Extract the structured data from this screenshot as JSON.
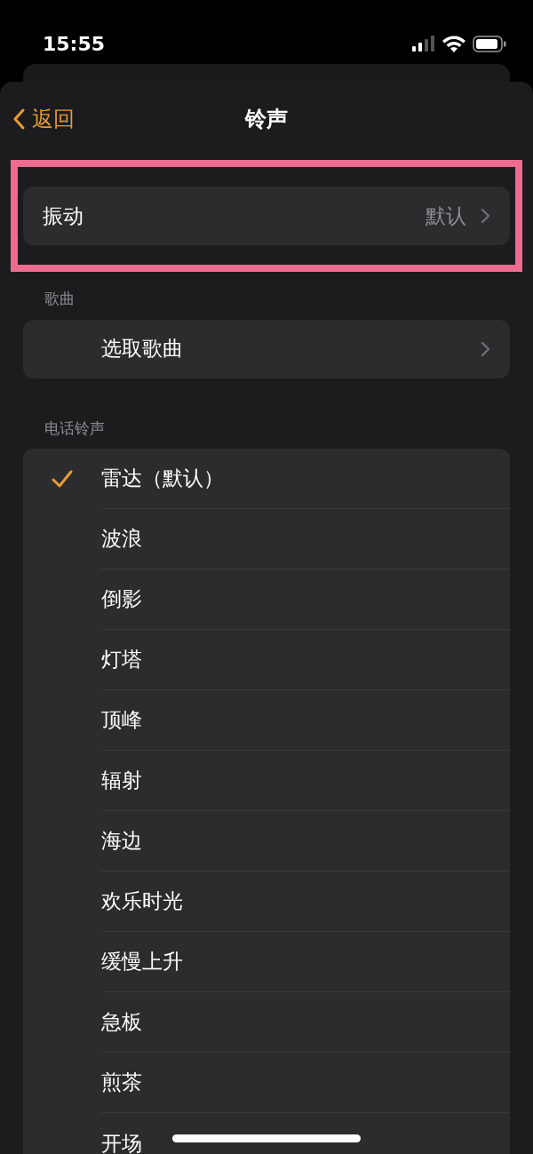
{
  "status_bar": {
    "time": "15:55"
  },
  "nav": {
    "back": "返回",
    "title": "铃声"
  },
  "vibration": {
    "label": "振动",
    "value": "默认",
    "highlighted": true
  },
  "sections": [
    {
      "header": "歌曲",
      "rows": [
        {
          "label": "选取歌曲",
          "kind": "link"
        }
      ]
    },
    {
      "header": "电话铃声",
      "rows": [
        {
          "label": "雷达（默认）",
          "kind": "option",
          "selected": true
        },
        {
          "label": "波浪",
          "kind": "option",
          "selected": false
        },
        {
          "label": "倒影",
          "kind": "option",
          "selected": false
        },
        {
          "label": "灯塔",
          "kind": "option",
          "selected": false
        },
        {
          "label": "顶峰",
          "kind": "option",
          "selected": false
        },
        {
          "label": "辐射",
          "kind": "option",
          "selected": false
        },
        {
          "label": "海边",
          "kind": "option",
          "selected": false
        },
        {
          "label": "欢乐时光",
          "kind": "option",
          "selected": false
        },
        {
          "label": "缓慢上升",
          "kind": "option",
          "selected": false
        },
        {
          "label": "急板",
          "kind": "option",
          "selected": false
        },
        {
          "label": "煎茶",
          "kind": "option",
          "selected": false
        },
        {
          "label": "开场",
          "kind": "option",
          "selected": false
        }
      ]
    }
  ]
}
